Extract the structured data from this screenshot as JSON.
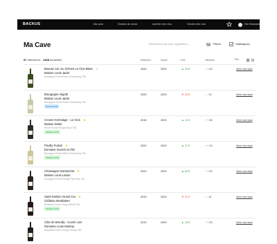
{
  "colors": {
    "topbar": "#0b0b0b",
    "up": "#2f9e44",
    "down": "#d9480f",
    "star": "#f2c200",
    "tag_green": "#d3f9d8",
    "tag_blue": "#d0ebff"
  },
  "header": {
    "brand": "BACKUS",
    "nav": [
      "Ma cave",
      "Gestion de stock",
      "Acheter des vins",
      "Vendre des vins"
    ],
    "user": "Eric Normand"
  },
  "page": {
    "title": "Ma Cave",
    "search_placeholder": "Recherchez par nom, appellation...",
    "filters_label": "Filtres",
    "stats_label": "Statistiques"
  },
  "list": {
    "summary_count": "57",
    "summary_text1": "références ·",
    "summary_bottles": "1468",
    "summary_text2": "bouteilles",
    "columns": {
      "vintage": "Millésime",
      "stock": "Dépôt",
      "price": "Cote",
      "variation": "Variation"
    },
    "sort_label": "Trier",
    "rows": [
      {
        "name": "Beaune 1er cru Grèves Le Clos Blanc",
        "producer": "Maison Louis Jadot",
        "region": "Bourgogne   France   Blanc   Chardonnay   75cl",
        "tag": "",
        "vintage": "2020",
        "stock": "2023",
        "price": "29 €",
        "trend": "up",
        "variation": "+ 23",
        "cta": "Gérer mon stock",
        "bottle": "#3a4a1e"
      },
      {
        "name": "Bourgogne Aligoté",
        "producer": "Maison Louis Jadot",
        "region": "Bourgogne   France   Blanc   Chardonnay   75cl",
        "tag": "Recommandé",
        "tag_color": "blue",
        "vintage": "2020",
        "stock": "2023",
        "price": "12 €",
        "trend": "down",
        "variation": "- 13",
        "cta": "Gérer mon stock",
        "bottle": "#c7c9a8"
      },
      {
        "name": "Crozes Hermitage - Le Clos",
        "producer": "Maison Delas",
        "region": "Rhône   France   Rouge   Syrah   75cl",
        "tag": "Apogée proche",
        "tag_color": "green",
        "vintage": "2016",
        "stock": "2023",
        "price": "41 €",
        "trend": "up",
        "variation": "+ 28",
        "cta": "Gérer mon stock",
        "bottle": "#2b2b2b"
      },
      {
        "name": "Pouilly-Fuissé",
        "producer": "Domaine Guerrin et Fils",
        "region": "Bourgogne   France   Blanc   Chardonnay   75cl",
        "tag": "Apogée proche",
        "tag_color": "green",
        "vintage": "2020",
        "stock": "2023",
        "price": "27 €",
        "trend": "up",
        "variation": "+ 13",
        "cta": "Gérer mon stock",
        "bottle": "#cfc79b"
      },
      {
        "name": "Chassagne Montrachet",
        "producer": "Maison Louis Latour",
        "region": "Bourgogne   France   Rouge   Pinot Noir   75cl",
        "tag": "",
        "vintage": "2020",
        "stock": "2023",
        "price": "66 €",
        "trend": "up",
        "variation": "+ 23",
        "cta": "Gérer mon stock",
        "bottle": "#2a2420"
      },
      {
        "name": "Saint-Emilion Grand Cru",
        "producer": "Château Montlabert",
        "region": "Bordeaux   France   Rouge   Merlot   75cl",
        "tag": "Apogée proche",
        "tag_color": "green",
        "vintage": "2019",
        "stock": "2023",
        "price": "47 €",
        "trend": "down",
        "variation": "- 12",
        "cta": "Gérer mon stock",
        "bottle": "#241818"
      },
      {
        "name": "Côte de Brouilly - Cuvée Lois",
        "producer": "Domaine Louis Martray",
        "region": "Beaujolais   France   Rouge   Gamay   75cl",
        "tag": "",
        "vintage": "2019",
        "stock": "2023",
        "price": "18 €",
        "trend": "up",
        "variation": "+ 23",
        "cta": "Gérer mon stock",
        "bottle": "#1f1f1f"
      }
    ]
  }
}
